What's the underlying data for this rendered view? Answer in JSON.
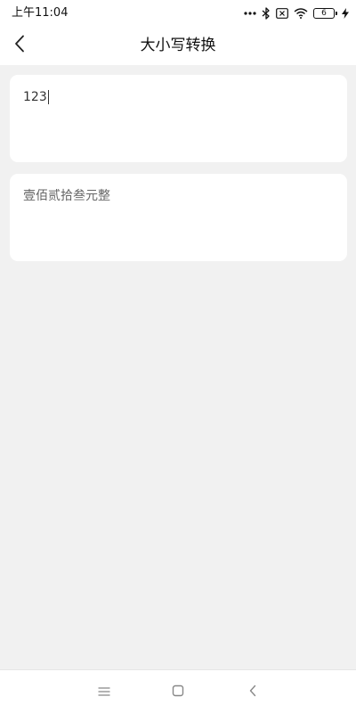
{
  "status_bar": {
    "time": "上午11:04",
    "battery_level": "6",
    "icons": [
      "more-dots-icon",
      "bluetooth-icon",
      "sim-disabled-icon",
      "wifi-icon",
      "battery-icon",
      "charging-icon"
    ]
  },
  "header": {
    "title": "大小写转换",
    "back_icon": "chevron-left-icon"
  },
  "input": {
    "value": "123"
  },
  "result": {
    "text": "壹佰贰拾叁元整"
  },
  "nav_bar": {
    "icons": [
      "menu-icon",
      "home-icon",
      "back-icon"
    ]
  },
  "colors": {
    "background": "#f1f1f1",
    "card": "#ffffff",
    "text": "#333333",
    "secondary_text": "#666666"
  }
}
